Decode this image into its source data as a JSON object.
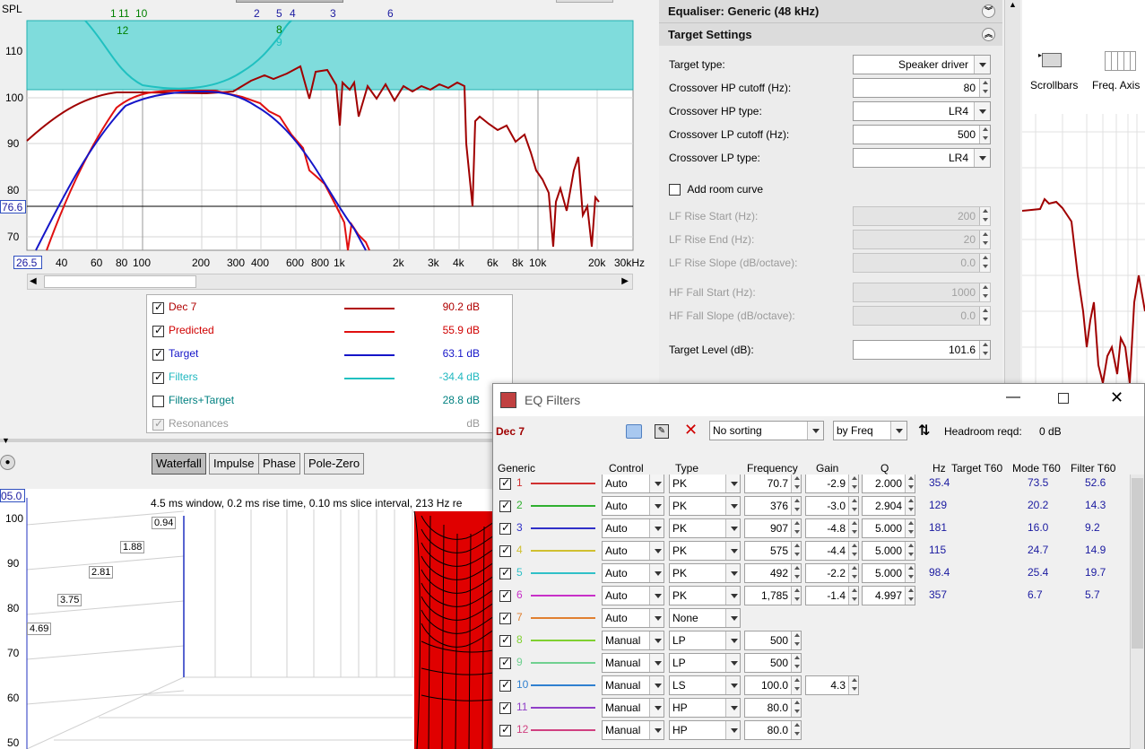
{
  "spl_graph": {
    "y_axis_title": "SPL",
    "y_ticks": [
      "110",
      "100",
      "90",
      "80",
      "70"
    ],
    "cursor_y_value": "76.6",
    "cursor_x_value": "26.5",
    "x_ticks": [
      "40",
      "60",
      "80",
      "100",
      "200",
      "300",
      "400",
      "600",
      "800",
      "1k",
      "2k",
      "3k",
      "4k",
      "6k",
      "8k",
      "10k",
      "20k",
      "30kHz"
    ],
    "filter_markers_top": [
      "1",
      "11",
      "10",
      "2",
      "5",
      "4",
      "3",
      "6"
    ],
    "filter_markers_low": [
      "12",
      "8",
      "9"
    ]
  },
  "legend": {
    "items": [
      {
        "label": "Dec 7",
        "value": "90.2 dB",
        "color": "#b00000",
        "checked": true
      },
      {
        "label": "Predicted",
        "value": "55.9 dB",
        "color": "#e01010",
        "checked": true
      },
      {
        "label": "Target",
        "value": "63.1 dB",
        "color": "#1515c8",
        "checked": true
      },
      {
        "label": "Filters",
        "value": "-34.4 dB",
        "color": "#20c0c0",
        "checked": true
      },
      {
        "label": "Filters+Target",
        "value": "28.8 dB",
        "color": "#008080",
        "checked": false
      },
      {
        "label": "Resonances",
        "value": "dB",
        "color": "#999999",
        "checked": true
      }
    ]
  },
  "waterfall": {
    "tabs": [
      "Waterfall",
      "Impulse",
      "Phase",
      "Pole-Zero"
    ],
    "selected_tab": "Waterfall",
    "cursor_value": "05.0",
    "info": "4.5 ms window, 0.2 ms rise time, 0.10 ms slice interval, 213 Hz re",
    "y_ticks": [
      "100",
      "90",
      "80",
      "70",
      "60",
      "50"
    ],
    "time_labels": [
      "0.94",
      "1.88",
      "2.81",
      "3.75",
      "4.69"
    ]
  },
  "equaliser": {
    "header": "Equaliser: Generic (48 kHz)",
    "section": "Target Settings",
    "fields": {
      "target_type_label": "Target type:",
      "target_type_value": "Speaker driver",
      "hp_cutoff_label": "Crossover HP cutoff (Hz):",
      "hp_cutoff_value": "80",
      "hp_type_label": "Crossover HP type:",
      "hp_type_value": "LR4",
      "lp_cutoff_label": "Crossover LP cutoff (Hz):",
      "lp_cutoff_value": "500",
      "lp_type_label": "Crossover LP type:",
      "lp_type_value": "LR4",
      "room_curve_label": "Add room curve",
      "lf_rise_start_label": "LF Rise Start (Hz):",
      "lf_rise_start_value": "200",
      "lf_rise_end_label": "LF Rise End (Hz):",
      "lf_rise_end_value": "20",
      "lf_rise_slope_label": "LF Rise Slope (dB/octave):",
      "lf_rise_slope_value": "0.0",
      "hf_fall_start_label": "HF Fall Start (Hz):",
      "hf_fall_start_value": "1000",
      "hf_fall_slope_label": "HF Fall Slope (dB/octave):",
      "hf_fall_slope_value": "0.0",
      "target_level_label": "Target Level (dB):",
      "target_level_value": "101.6"
    }
  },
  "toolbar_right": {
    "scrollbars_label": "Scrollbars",
    "freq_axis_label": "Freq. Axis"
  },
  "eq_filters": {
    "title": "EQ Filters",
    "measurement": "Dec 7",
    "sorting": "No sorting",
    "sort_by": "by Freq",
    "headroom_label": "Headroom reqd:",
    "headroom_value": "0 dB",
    "columns": [
      "Generic",
      "Control",
      "Type",
      "Frequency",
      "Gain",
      "Q",
      "Hz",
      "Target T60",
      "Mode T60",
      "Filter T60"
    ],
    "rows": [
      {
        "n": "1",
        "color": "#d03030",
        "control": "Auto",
        "type": "PK",
        "freq": "70.7",
        "gain": "-2.9",
        "q": "2.000",
        "hz": "35.4",
        "target": "",
        "mode": "73.5",
        "filter": "52.6"
      },
      {
        "n": "2",
        "color": "#30b030",
        "control": "Auto",
        "type": "PK",
        "freq": "376",
        "gain": "-3.0",
        "q": "2.904",
        "hz": "129",
        "target": "",
        "mode": "20.2",
        "filter": "14.3"
      },
      {
        "n": "3",
        "color": "#3030c8",
        "control": "Auto",
        "type": "PK",
        "freq": "907",
        "gain": "-4.8",
        "q": "5.000",
        "hz": "181",
        "target": "",
        "mode": "16.0",
        "filter": "9.2"
      },
      {
        "n": "4",
        "color": "#d0c030",
        "control": "Auto",
        "type": "PK",
        "freq": "575",
        "gain": "-4.4",
        "q": "5.000",
        "hz": "115",
        "target": "",
        "mode": "24.7",
        "filter": "14.9"
      },
      {
        "n": "5",
        "color": "#30c0c8",
        "control": "Auto",
        "type": "PK",
        "freq": "492",
        "gain": "-2.2",
        "q": "5.000",
        "hz": "98.4",
        "target": "",
        "mode": "25.4",
        "filter": "19.7"
      },
      {
        "n": "6",
        "color": "#c830c8",
        "control": "Auto",
        "type": "PK",
        "freq": "1,785",
        "gain": "-1.4",
        "q": "4.997",
        "hz": "357",
        "target": "",
        "mode": "6.7",
        "filter": "5.7"
      },
      {
        "n": "7",
        "color": "#e08030",
        "control": "Auto",
        "type": "None",
        "freq": "",
        "gain": "",
        "q": "",
        "hz": "",
        "target": "",
        "mode": "",
        "filter": ""
      },
      {
        "n": "8",
        "color": "#80d030",
        "control": "Manual",
        "type": "LP",
        "freq": "500",
        "gain": "",
        "q": "",
        "hz": "",
        "target": "",
        "mode": "",
        "filter": ""
      },
      {
        "n": "9",
        "color": "#70d090",
        "control": "Manual",
        "type": "LP",
        "freq": "500",
        "gain": "",
        "q": "",
        "hz": "",
        "target": "",
        "mode": "",
        "filter": ""
      },
      {
        "n": "10",
        "color": "#3080d0",
        "control": "Manual",
        "type": "LS",
        "freq": "100.0",
        "gain": "4.3",
        "q": "",
        "hz": "",
        "target": "",
        "mode": "",
        "filter": ""
      },
      {
        "n": "11",
        "color": "#9040c8",
        "control": "Manual",
        "type": "HP",
        "freq": "80.0",
        "gain": "",
        "q": "",
        "hz": "",
        "target": "",
        "mode": "",
        "filter": ""
      },
      {
        "n": "12",
        "color": "#d04080",
        "control": "Manual",
        "type": "HP",
        "freq": "80.0",
        "gain": "",
        "q": "",
        "hz": "",
        "target": "",
        "mode": "",
        "filter": ""
      }
    ]
  }
}
